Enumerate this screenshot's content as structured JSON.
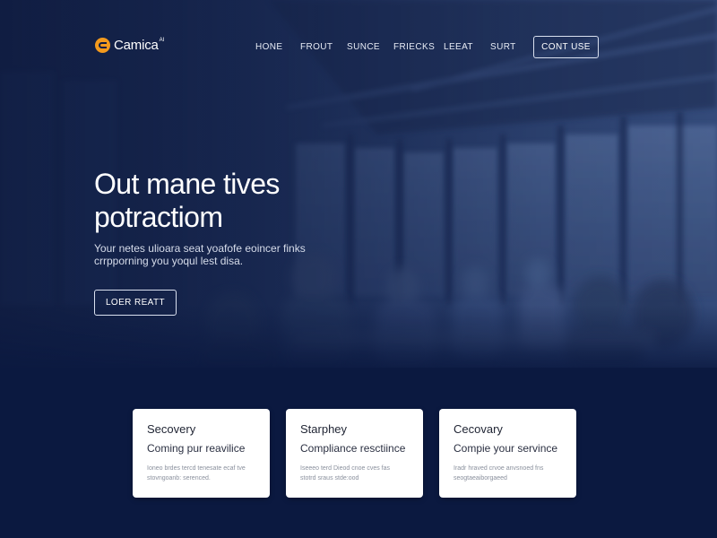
{
  "brand": {
    "name": "Camica",
    "superscript": "AI",
    "accent_color": "#f39a1d"
  },
  "nav": {
    "items": [
      {
        "label": "HONE"
      },
      {
        "label": "FROUT"
      },
      {
        "label": "SUNCE"
      },
      {
        "label": "FRIECKS"
      },
      {
        "label": "LEEAT"
      },
      {
        "label": "SURT"
      }
    ],
    "contact_label": "CONT USE"
  },
  "hero": {
    "title_line1": "Out mane tives",
    "title_line2": "potractiom",
    "subtitle_line1": "Your netes ulioara seat yoafofe eoincer finks",
    "subtitle_line2": "crrpporning you yoqul lest disa.",
    "cta_label": "LOER REATT"
  },
  "cards": [
    {
      "title": "Secovery",
      "subtitle": "Coming pur reavilice",
      "body_line1": "Ioneo brdes tercd tenesate ecaf tve",
      "body_line2": "stovngoanb: serenced."
    },
    {
      "title": "Starphey",
      "subtitle": "Compliance resctiince",
      "body_line1": "Iseeeo terd Dieod cnoe cves fas",
      "body_line2": "stotrd sraus stde:ood"
    },
    {
      "title": "Cecovary",
      "subtitle": "Compie your servince",
      "body_line1": "Iradr hraved crvoe anvsnoed fns",
      "body_line2": "seogtaeaiborgaeed"
    }
  ],
  "colors": {
    "hero_dark": "#0e1a3e",
    "section_bg": "#0b1940",
    "card_bg": "#ffffff"
  }
}
